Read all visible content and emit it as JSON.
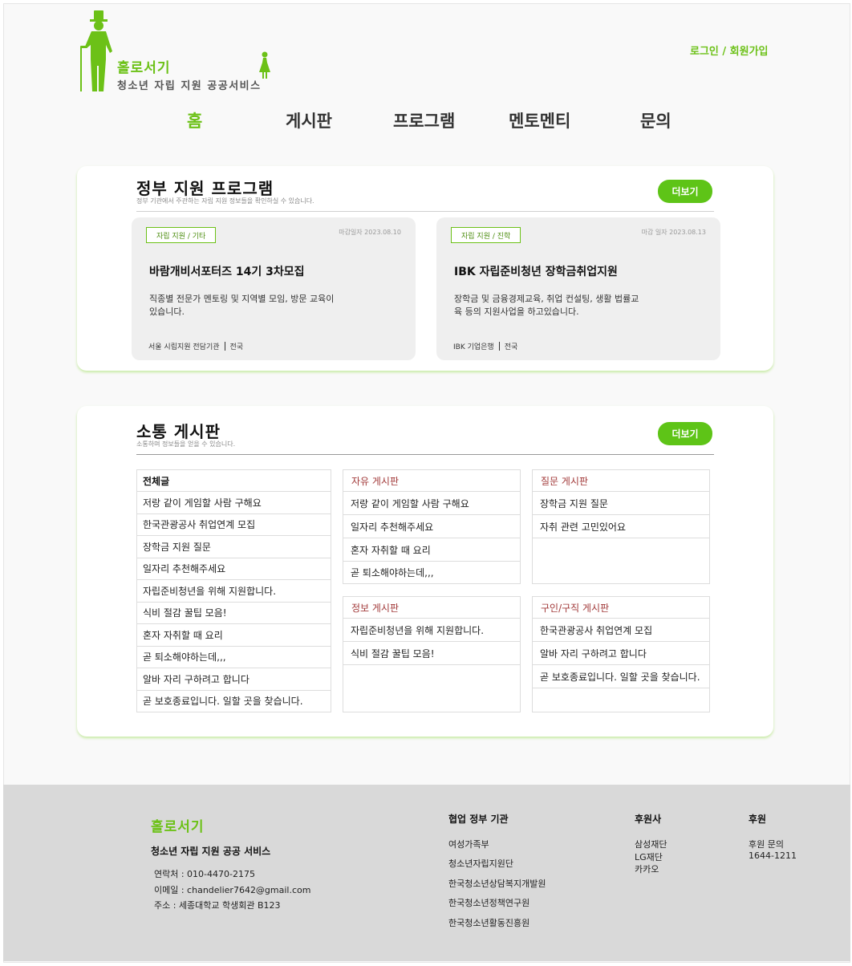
{
  "header": {
    "logo_title": "홀로서기",
    "logo_subtitle": "청소년 자립 지원 공공서비스",
    "auth": "로그인 / 회원가입",
    "brand_color": "#6cc117"
  },
  "nav": {
    "items": [
      {
        "label": "홈",
        "active": true
      },
      {
        "label": "게시판"
      },
      {
        "label": "프로그램"
      },
      {
        "label": "멘토멘티"
      },
      {
        "label": "문의"
      }
    ]
  },
  "gov": {
    "title": "정부 지원 프로그램",
    "subtitle": "정부 기관에서 주관하는 자립 지원 정보들을 확인하실 수 있습니다.",
    "more": "더보기",
    "cards": [
      {
        "tag": "자립 지원 / 기타",
        "deadline": "마감일자 2023.08.10",
        "title": "바람개비서포터즈 14기 3차모집",
        "desc": "직종별 전문가 멘토링 및 지역별 모임, 방문 교육이 있습니다.",
        "org": "서울 시립지원 전담기관",
        "region": "전국"
      },
      {
        "tag": "자립 지원 / 진학",
        "deadline": "마감 일자 2023.08.13",
        "title": "IBK 자립준비청년 장학금취업지원",
        "desc": "장학금 및 금융경제교육, 취업 컨설팅, 생활 법률교육 등의 지원사업을 하고있습니다.",
        "org": "IBK 기업은행",
        "region": "전국"
      }
    ]
  },
  "community": {
    "title": "소통 게시판",
    "subtitle": "소통하며 정보들을 얻을 수 있습니다.",
    "more": "더보기",
    "all": {
      "header": "전체글",
      "posts": [
        "저랑 같이 게임할 사람 구해요",
        "한국관광공사 취업연계 모집",
        "장학금 지원 질문",
        "일자리 추천해주세요",
        "자립준비청년을 위해 지원합니다.",
        "식비 절감 꿀팁 모음!",
        "혼자 자취할 때 요리",
        "곧 퇴소해야하는데,,,",
        "알바 자리 구하려고 합니다",
        "곧 보호종료입니다. 일할 곳을 찾습니다."
      ]
    },
    "free": {
      "header": "자유 게시판",
      "posts": [
        "저랑 같이 게임할 사람 구해요",
        "일자리 추천해주세요",
        "혼자 자취할 때 요리",
        "곧 퇴소해야하는데,,,"
      ]
    },
    "question": {
      "header": "질문 게시판",
      "posts": [
        "장학금 지원 질문",
        "자취 관련 고민있어요"
      ]
    },
    "info": {
      "header": "정보 게시판",
      "posts": [
        "자립준비청년을 위해 지원합니다.",
        "식비 절감 꿀팁 모음!"
      ]
    },
    "jobs": {
      "header": "구인/구직 게시판",
      "posts": [
        "한국관광공사 취업연계 모집",
        "알바 자리 구하려고 합니다",
        "곧 보호종료입니다. 일할 곳을 찾습니다."
      ]
    }
  },
  "footer": {
    "title": "홀로서기",
    "subtitle": "청소년 자립 지원 공공 서비스",
    "contact": "연락처 : 010-4470-2175",
    "email": "이메일 : chandelier7642@gmail.com",
    "address": "주소 : 세종대학교 학생회관 B123",
    "partners_title": "협업 정부 기관",
    "partners": [
      "여성가족부",
      "청소년자립지원단",
      "한국청소년상담복지개발원",
      "한국청소년정책연구원",
      "한국청소년활동진흥원"
    ],
    "sponsors_title": "후원사",
    "sponsors": [
      "삼성재단",
      "LG재단",
      "카카오"
    ],
    "donate_title": "후원",
    "donate_label": "후원 문의",
    "donate_phone": "1644-1211"
  }
}
